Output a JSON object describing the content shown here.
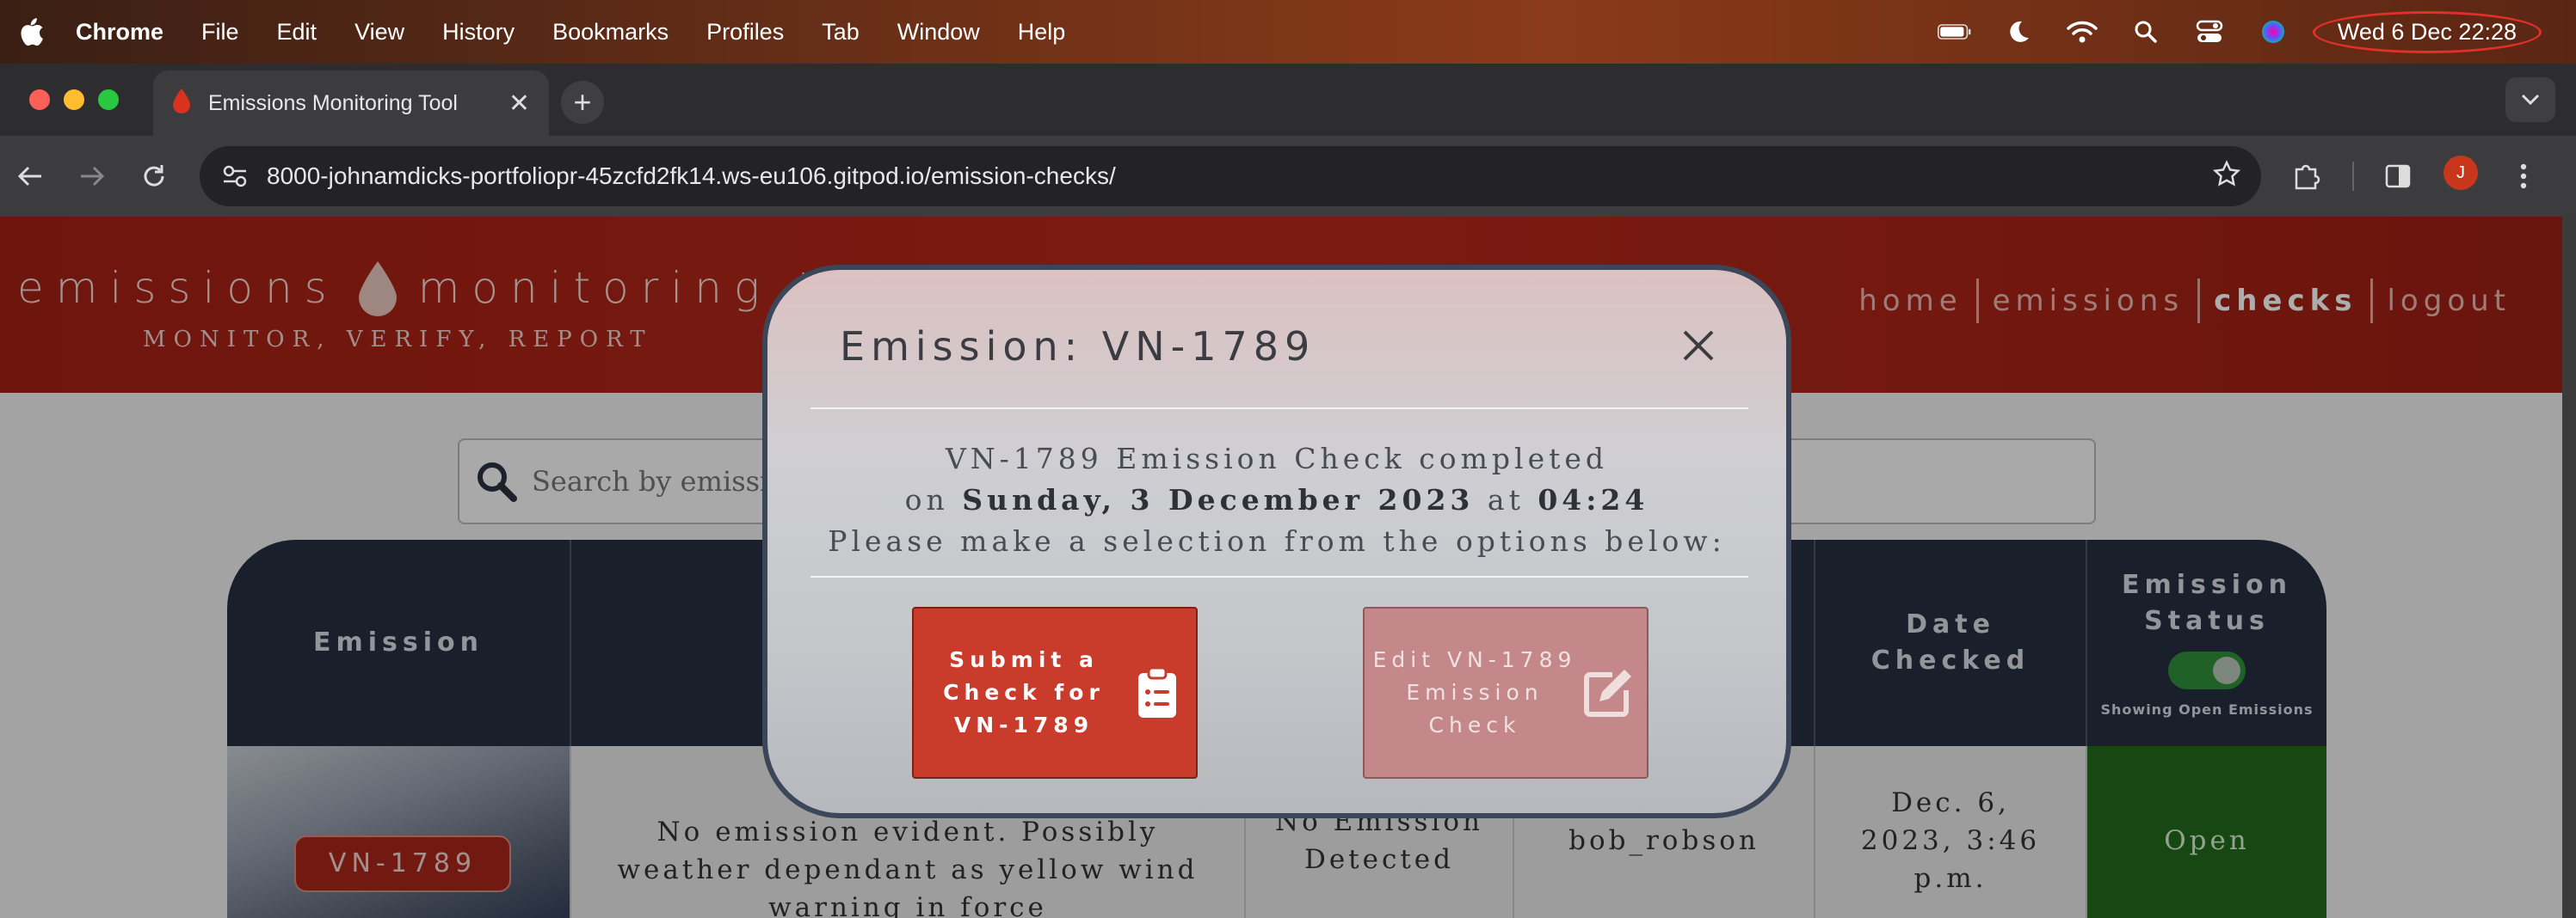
{
  "menubar": {
    "app": "Chrome",
    "items": [
      "File",
      "Edit",
      "View",
      "History",
      "Bookmarks",
      "Profiles",
      "Tab",
      "Window",
      "Help"
    ],
    "clock": "Wed 6 Dec  22:28"
  },
  "browser": {
    "tab_title": "Emissions Monitoring Tool",
    "url_host": "8000-johnamdicks-portfoliopr-45zcfd2fk14.ws-eu106.gitpod.io",
    "url_path": "/emission-checks/",
    "profile_initial": "J"
  },
  "site": {
    "title_left": "emissions",
    "title_right": "monitoring tool",
    "tagline": "MONITOR, VERIFY, REPORT",
    "nav": [
      "home",
      "emissions",
      "checks",
      "logout"
    ],
    "search_placeholder": "Search by emission"
  },
  "table": {
    "headers": {
      "emission": "Emission",
      "date_checked": "Date Checked",
      "emission_status": "Emission Status",
      "toggle_caption": "Showing Open Emissions"
    },
    "row": {
      "emission": "VN-1789",
      "description": "No emission evident. Possibly weather dependant as yellow wind warning in force",
      "result": "No Emission Detected",
      "user": "bob_robson",
      "date": "Dec. 6, 2023, 3:46 p.m.",
      "status": "Open"
    }
  },
  "modal": {
    "title": "Emission: VN-1789",
    "line1": "VN-1789 Emission Check completed",
    "line2_prefix": "on ",
    "line2_date": "Sunday, 3 December 2023",
    "line2_mid": " at ",
    "line2_time": "04:24",
    "line3": "Please make a selection from the options below:",
    "submit_label": "Submit a Check for VN-1789",
    "edit_label": "Edit VN-1789 Emission Check"
  },
  "colors": {
    "header_red": "#b7291b",
    "primary_button": "#c93b2b",
    "status_open": "#226b1c",
    "table_header": "#273040"
  }
}
